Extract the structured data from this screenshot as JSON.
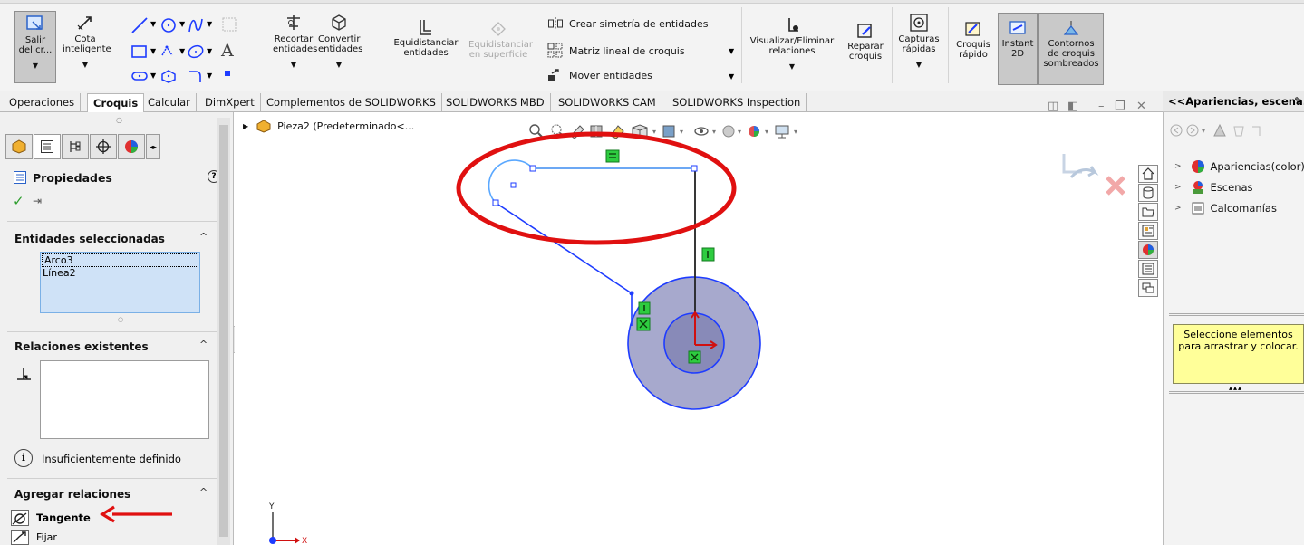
{
  "ribbon": {
    "salir": "Salir del cr...",
    "cota": "Cota inteligente",
    "recortar": "Recortar entidades",
    "convertir": "Convertir entidades",
    "equidistanciar": "Equidistanciar entidades",
    "equidistanciar_sup": "Equidistanciar en superficie",
    "simetria": "Crear simetría de entidades",
    "matriz": "Matriz lineal de croquis",
    "mover": "Mover entidades",
    "visualizar": "Visualizar/Eliminar relaciones",
    "reparar": "Reparar croquis",
    "capturas": "Capturas rápidas",
    "croquis_rapido": "Croquis rápido",
    "instant2d": "Instant 2D",
    "contornos": "Contornos de croquis sombreados"
  },
  "tabs": [
    "Operaciones",
    "Croquis",
    "Calcular",
    "DimXpert",
    "Complementos de SOLIDWORKS",
    "SOLIDWORKS MBD",
    "SOLIDWORKS CAM",
    "SOLIDWORKS Inspection"
  ],
  "tree": {
    "label": "Pieza2  (Predeterminado<..."
  },
  "panel": {
    "title": "Propiedades",
    "help": "?",
    "section_selected": "Entidades seleccionadas",
    "selected_items": [
      "Arco3",
      "Línea2"
    ],
    "section_existing": "Relaciones existentes",
    "status": "Insuficientemente definido",
    "section_add": "Agregar relaciones",
    "add_items": [
      "Tangente",
      "Fijar"
    ]
  },
  "right": {
    "header": "<<Apariencias, escena...",
    "items": [
      "Apariencias(color)",
      "Escenas",
      "Calcomanías"
    ],
    "tooltip": "Seleccione elementos para arrastrar y colocar."
  },
  "colors": {
    "sketch_blue": "#1e3cff",
    "highlight_red": "#e01010",
    "relation_green": "#2ecc40"
  }
}
